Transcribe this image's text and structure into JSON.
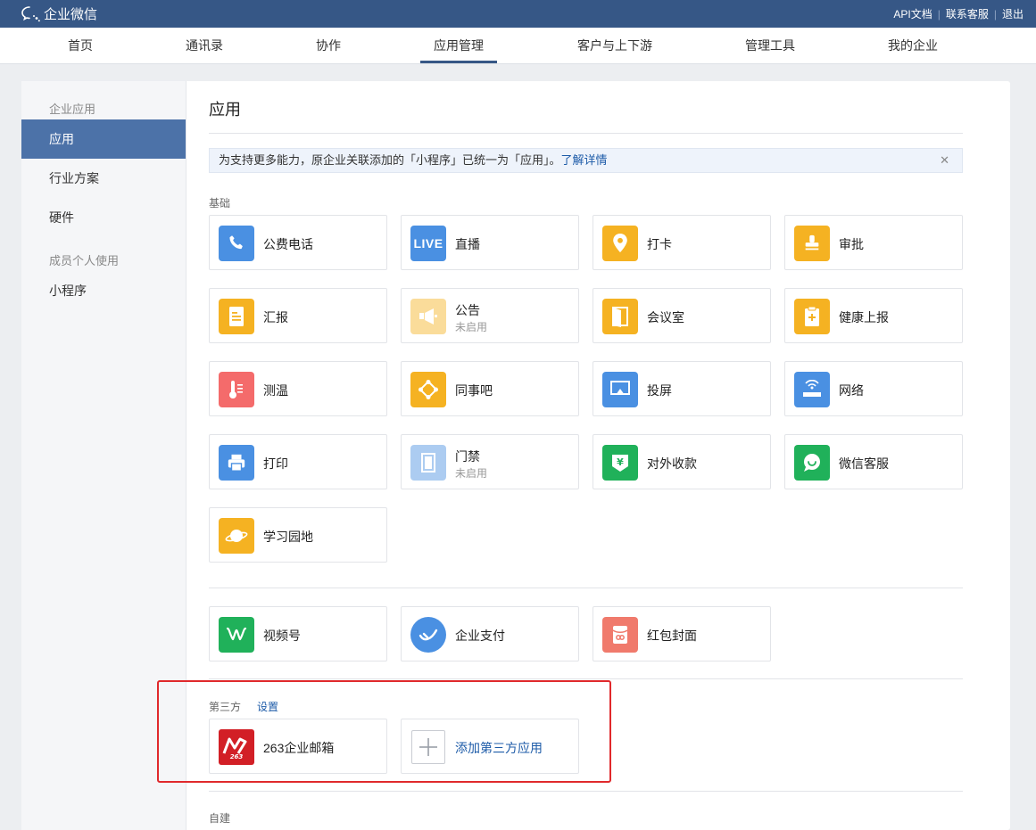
{
  "topbar": {
    "title": "企业微信",
    "links": [
      "API文档",
      "联系客服",
      "退出"
    ]
  },
  "nav": {
    "tabs": [
      "首页",
      "通讯录",
      "协作",
      "应用管理",
      "客户与上下游",
      "管理工具",
      "我的企业"
    ],
    "active": "应用管理"
  },
  "sidebar": {
    "group1": "企业应用",
    "items1": [
      "应用",
      "行业方案",
      "硬件"
    ],
    "group2": "成员个人使用",
    "items2": [
      "小程序"
    ]
  },
  "main": {
    "title": "应用",
    "notice": {
      "text": "为支持更多能力，原企业关联添加的「小程序」已统一为「应用」。",
      "link": "了解详情",
      "close": "✕"
    },
    "basic_label": "基础",
    "basic_apps": [
      {
        "name": "公费电话",
        "icon": "phone-icon",
        "color": "#4a90e2"
      },
      {
        "name": "直播",
        "icon": "live-icon",
        "color": "#4a90e2"
      },
      {
        "name": "打卡",
        "icon": "location-pin-icon",
        "color": "#f5b222"
      },
      {
        "name": "审批",
        "icon": "stamp-icon",
        "color": "#f5b222"
      },
      {
        "name": "汇报",
        "icon": "report-icon",
        "color": "#f5b222"
      },
      {
        "name": "公告",
        "status": "未启用",
        "icon": "megaphone-icon",
        "color": "#f5b222"
      },
      {
        "name": "会议室",
        "icon": "door-icon",
        "color": "#f5b222"
      },
      {
        "name": "健康上报",
        "icon": "clipboard-plus-icon",
        "color": "#f5b222"
      },
      {
        "name": "测温",
        "icon": "thermometer-icon",
        "color": "#f46b6b"
      },
      {
        "name": "同事吧",
        "icon": "network-icon",
        "color": "#f5b222"
      },
      {
        "name": "投屏",
        "icon": "screen-cast-icon",
        "color": "#4a90e2"
      },
      {
        "name": "网络",
        "icon": "router-icon",
        "color": "#4a90e2"
      },
      {
        "name": "打印",
        "icon": "printer-icon",
        "color": "#4a90e2"
      },
      {
        "name": "门禁",
        "status": "未启用",
        "icon": "gate-icon",
        "color": "#4a90e2"
      },
      {
        "name": "对外收款",
        "icon": "yuan-shield-icon",
        "color": "#20b15a"
      },
      {
        "name": "微信客服",
        "icon": "chat-bubble-icon",
        "color": "#20b15a"
      },
      {
        "name": "学习园地",
        "icon": "planet-icon",
        "color": "#f5b222"
      }
    ],
    "extra_apps": [
      {
        "name": "视频号",
        "icon": "channels-icon",
        "color": "#20b15a"
      },
      {
        "name": "企业支付",
        "icon": "wallet-icon",
        "color": "#4a90e2"
      },
      {
        "name": "红包封面",
        "icon": "red-envelope-icon",
        "color": "#f07a6c"
      }
    ],
    "third_label": "第三方",
    "third_setting": "设置",
    "third_apps": [
      {
        "name": "263企业邮箱",
        "icon": "263-mail-logo",
        "color": "#d21f26"
      },
      {
        "name": "添加第三方应用",
        "icon": "plus-icon",
        "color": "#ffffff"
      }
    ],
    "custom_label": "自建"
  }
}
